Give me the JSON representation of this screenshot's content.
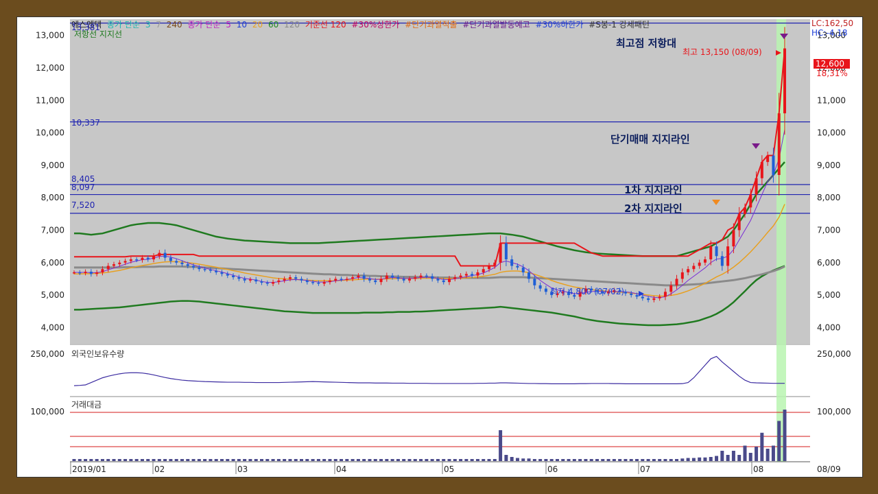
{
  "legend": {
    "stock": "에스엔텍",
    "ma_label": "종가 단순",
    "ma_periods_a": [
      "3",
      "7",
      "240"
    ],
    "ma_label_b": "종가 단순",
    "ma_periods_b": [
      "5",
      "10",
      "20",
      "60",
      "120"
    ],
    "base_line": "기준선 120",
    "items": [
      "#30%상한가",
      "#단기과열적출",
      "#단기과열발동예고",
      "#30%하한가",
      "#S봉-1 강세패턴"
    ],
    "sub_label": "저항선 지지선"
  },
  "top_right": {
    "lc": "LC:162,50",
    "hc": "HC:-4,18"
  },
  "price_badge": "12,600",
  "price_pct": "18,31%",
  "annotations": {
    "resist": "최고점 저항대",
    "short": "단기매매 지지라인",
    "s1": "1차 지지라인",
    "s2": "2차 지지라인",
    "high": "최고 13,150 (08/09)",
    "low": "최저 4,800 (07/02)"
  },
  "lines": {
    "top": "13,381",
    "l1": "10,337",
    "l2": "8,405",
    "l3": "8,097",
    "l4": "7,520"
  },
  "panels": {
    "foreign": "외국인보유수량",
    "amount": "거래대금"
  },
  "colors": {
    "up": "#e8151b",
    "down": "#1f5fd6",
    "band": "#1f7a1f",
    "hline": "#1e22b0"
  },
  "chart_data": {
    "type": "candlestick",
    "price_axis": {
      "ylim": [
        3500,
        13500
      ],
      "ticks": [
        4000,
        5000,
        6000,
        7000,
        8000,
        9000,
        10000,
        11000,
        12000,
        13000
      ],
      "tick_labels": [
        "4,000",
        "5,000",
        "6,000",
        "7,000",
        "8,000",
        "9,000",
        "10,000",
        "11,000",
        "12,000",
        "13,000"
      ]
    },
    "x_ticks": [
      "2019/01",
      "02",
      "03",
      "04",
      "05",
      "06",
      "07",
      "08"
    ],
    "x_last": "08/09",
    "hlines": [
      13381,
      10337,
      8405,
      8097,
      7520
    ],
    "price_close": [
      5700,
      5680,
      5720,
      5650,
      5700,
      5800,
      5900,
      5950,
      6000,
      6050,
      6100,
      6080,
      6150,
      6100,
      6200,
      6300,
      6150,
      6050,
      6000,
      5950,
      5900,
      5850,
      5800,
      5780,
      5750,
      5700,
      5650,
      5600,
      5550,
      5500,
      5450,
      5480,
      5420,
      5380,
      5350,
      5400,
      5450,
      5500,
      5550,
      5500,
      5450,
      5400,
      5380,
      5350,
      5400,
      5450,
      5500,
      5480,
      5500,
      5550,
      5600,
      5500,
      5450,
      5400,
      5500,
      5600,
      5550,
      5500,
      5450,
      5500,
      5550,
      5600,
      5580,
      5500,
      5450,
      5400,
      5500,
      5550,
      5600,
      5650,
      5600,
      5700,
      5800,
      5900,
      6000,
      6600,
      6100,
      5900,
      5850,
      5700,
      5500,
      5300,
      5200,
      5100,
      5000,
      5050,
      5100,
      5000,
      4950,
      5100,
      5200,
      5150,
      5100,
      5050,
      5100,
      5150,
      5100,
      5050,
      5000,
      4950,
      4900,
      4850,
      4900,
      4950,
      5100,
      5300,
      5500,
      5700,
      5800,
      5900,
      6000,
      6100,
      6500,
      6200,
      5900,
      6500,
      7000,
      7500,
      7700,
      8100,
      8600,
      9100,
      9300,
      8700,
      10600,
      12600
    ],
    "ma_short": [
      5700,
      5700,
      5700,
      5690,
      5690,
      5720,
      5780,
      5830,
      5890,
      5950,
      6010,
      6050,
      6090,
      6100,
      6140,
      6190,
      6200,
      6170,
      6120,
      6060,
      5990,
      5930,
      5880,
      5830,
      5790,
      5750,
      5710,
      5660,
      5610,
      5560,
      5510,
      5490,
      5460,
      5420,
      5390,
      5390,
      5410,
      5440,
      5470,
      5480,
      5470,
      5450,
      5420,
      5400,
      5400,
      5410,
      5440,
      5460,
      5480,
      5510,
      5540,
      5530,
      5510,
      5480,
      5490,
      5520,
      5540,
      5530,
      5510,
      5510,
      5520,
      5540,
      5550,
      5540,
      5510,
      5480,
      5480,
      5500,
      5530,
      5570,
      5600,
      5630,
      5680,
      5760,
      5850,
      6000,
      6050,
      6000,
      5950,
      5870,
      5750,
      5600,
      5450,
      5330,
      5220,
      5160,
      5120,
      5080,
      5040,
      5050,
      5080,
      5110,
      5120,
      5110,
      5100,
      5110,
      5110,
      5100,
      5080,
      5040,
      5000,
      4960,
      4930,
      4920,
      4950,
      5040,
      5160,
      5300,
      5450,
      5580,
      5710,
      5840,
      6000,
      6110,
      6130,
      6200,
      6400,
      6700,
      7000,
      7300,
      7700,
      8100,
      8500,
      8700,
      9200,
      10100
    ],
    "ma_mid": [
      5650,
      5650,
      5660,
      5660,
      5670,
      5680,
      5700,
      5730,
      5760,
      5800,
      5840,
      5880,
      5910,
      5940,
      5970,
      6000,
      6020,
      6030,
      6030,
      6020,
      6000,
      5980,
      5950,
      5920,
      5890,
      5860,
      5820,
      5790,
      5750,
      5720,
      5680,
      5650,
      5620,
      5590,
      5560,
      5530,
      5510,
      5500,
      5490,
      5480,
      5470,
      5460,
      5450,
      5440,
      5440,
      5440,
      5440,
      5450,
      5460,
      5470,
      5480,
      5490,
      5490,
      5490,
      5490,
      5500,
      5500,
      5510,
      5510,
      5510,
      5510,
      5520,
      5520,
      5520,
      5520,
      5510,
      5510,
      5510,
      5520,
      5530,
      5540,
      5560,
      5580,
      5610,
      5640,
      5700,
      5730,
      5740,
      5740,
      5720,
      5690,
      5640,
      5580,
      5520,
      5450,
      5390,
      5340,
      5290,
      5250,
      5220,
      5190,
      5170,
      5150,
      5130,
      5110,
      5100,
      5090,
      5080,
      5060,
      5040,
      5020,
      5000,
      4980,
      4970,
      4970,
      4990,
      5020,
      5070,
      5130,
      5200,
      5280,
      5360,
      5460,
      5560,
      5640,
      5740,
      5860,
      6000,
      6160,
      6330,
      6520,
      6720,
      6930,
      7130,
      7400,
      7800
    ],
    "ma_long": [
      5850,
      5850,
      5850,
      5850,
      5850,
      5850,
      5850,
      5850,
      5850,
      5860,
      5860,
      5860,
      5870,
      5870,
      5870,
      5880,
      5880,
      5880,
      5880,
      5880,
      5870,
      5870,
      5860,
      5850,
      5840,
      5830,
      5820,
      5810,
      5800,
      5790,
      5780,
      5770,
      5760,
      5750,
      5740,
      5730,
      5720,
      5710,
      5700,
      5690,
      5680,
      5670,
      5660,
      5650,
      5640,
      5640,
      5630,
      5620,
      5620,
      5610,
      5600,
      5600,
      5590,
      5590,
      5580,
      5580,
      5570,
      5570,
      5560,
      5560,
      5560,
      5550,
      5550,
      5550,
      5540,
      5540,
      5540,
      5530,
      5530,
      5530,
      5530,
      5530,
      5530,
      5530,
      5540,
      5550,
      5550,
      5550,
      5550,
      5550,
      5540,
      5530,
      5520,
      5510,
      5500,
      5490,
      5480,
      5470,
      5460,
      5450,
      5440,
      5430,
      5420,
      5410,
      5400,
      5390,
      5380,
      5370,
      5360,
      5350,
      5340,
      5330,
      5320,
      5310,
      5300,
      5300,
      5300,
      5310,
      5320,
      5330,
      5340,
      5360,
      5380,
      5400,
      5420,
      5440,
      5460,
      5490,
      5520,
      5560,
      5600,
      5640,
      5690,
      5740,
      5800,
      5880
    ],
    "resist_line": [
      6180,
      6180,
      6180,
      6180,
      6180,
      6180,
      6180,
      6180,
      6180,
      6180,
      6200,
      6200,
      6200,
      6200,
      6200,
      6250,
      6250,
      6250,
      6250,
      6250,
      6250,
      6250,
      6200,
      6200,
      6200,
      6200,
      6200,
      6200,
      6200,
      6200,
      6200,
      6200,
      6200,
      6200,
      6200,
      6200,
      6200,
      6200,
      6200,
      6200,
      6200,
      6200,
      6200,
      6200,
      6200,
      6200,
      6200,
      6200,
      6200,
      6200,
      6200,
      6200,
      6200,
      6200,
      6200,
      6200,
      6200,
      6200,
      6200,
      6200,
      6200,
      6200,
      6200,
      6200,
      6200,
      6200,
      6200,
      6200,
      5900,
      5900,
      5900,
      5900,
      5900,
      5900,
      5900,
      6600,
      6600,
      6600,
      6600,
      6600,
      6600,
      6600,
      6600,
      6600,
      6600,
      6600,
      6600,
      6600,
      6600,
      6500,
      6400,
      6300,
      6250,
      6200,
      6200,
      6200,
      6200,
      6200,
      6200,
      6200,
      6200,
      6200,
      6200,
      6200,
      6200,
      6200,
      6200,
      6200,
      6200,
      6300,
      6400,
      6500,
      6600,
      6600,
      6700,
      7000,
      7100,
      7500,
      7700,
      8100,
      8600,
      9100,
      9300,
      9300,
      10600,
      12600
    ],
    "band_upper": [
      6900,
      6900,
      6880,
      6860,
      6880,
      6900,
      6950,
      7000,
      7050,
      7100,
      7150,
      7180,
      7200,
      7220,
      7220,
      7220,
      7200,
      7180,
      7150,
      7100,
      7050,
      7000,
      6950,
      6900,
      6850,
      6800,
      6770,
      6740,
      6720,
      6700,
      6680,
      6670,
      6660,
      6650,
      6640,
      6630,
      6620,
      6610,
      6600,
      6600,
      6600,
      6600,
      6600,
      6600,
      6610,
      6620,
      6630,
      6640,
      6650,
      6660,
      6670,
      6680,
      6690,
      6700,
      6710,
      6720,
      6730,
      6740,
      6750,
      6760,
      6770,
      6780,
      6790,
      6800,
      6810,
      6820,
      6830,
      6840,
      6850,
      6860,
      6870,
      6880,
      6890,
      6900,
      6900,
      6900,
      6880,
      6860,
      6830,
      6800,
      6750,
      6700,
      6650,
      6600,
      6550,
      6500,
      6460,
      6420,
      6380,
      6350,
      6320,
      6300,
      6280,
      6270,
      6260,
      6250,
      6240,
      6230,
      6220,
      6210,
      6200,
      6200,
      6200,
      6200,
      6200,
      6200,
      6200,
      6250,
      6300,
      6350,
      6400,
      6450,
      6500,
      6600,
      6700,
      6800,
      7000,
      7250,
      7500,
      7800,
      8100,
      8300,
      8500,
      8700,
      8900,
      9100
    ],
    "band_lower": [
      4550,
      4550,
      4560,
      4570,
      4580,
      4590,
      4600,
      4610,
      4620,
      4640,
      4660,
      4680,
      4700,
      4720,
      4740,
      4760,
      4780,
      4800,
      4810,
      4820,
      4820,
      4810,
      4800,
      4780,
      4760,
      4740,
      4720,
      4700,
      4680,
      4660,
      4640,
      4620,
      4600,
      4580,
      4560,
      4540,
      4520,
      4500,
      4490,
      4480,
      4470,
      4460,
      4450,
      4450,
      4450,
      4450,
      4450,
      4450,
      4450,
      4450,
      4450,
      4460,
      4460,
      4460,
      4460,
      4470,
      4470,
      4480,
      4480,
      4480,
      4490,
      4490,
      4500,
      4510,
      4520,
      4530,
      4540,
      4550,
      4560,
      4570,
      4580,
      4590,
      4600,
      4610,
      4620,
      4640,
      4620,
      4600,
      4580,
      4560,
      4540,
      4520,
      4500,
      4480,
      4460,
      4430,
      4400,
      4370,
      4340,
      4300,
      4260,
      4230,
      4200,
      4180,
      4160,
      4140,
      4120,
      4110,
      4100,
      4090,
      4080,
      4070,
      4070,
      4070,
      4080,
      4090,
      4100,
      4120,
      4150,
      4180,
      4220,
      4280,
      4340,
      4420,
      4520,
      4640,
      4780,
      4950,
      5120,
      5300,
      5460,
      5580,
      5680,
      5760,
      5830,
      5900
    ],
    "foreign_holdings": [
      60,
      62,
      65,
      80,
      95,
      110,
      120,
      128,
      135,
      140,
      142,
      142,
      140,
      135,
      128,
      120,
      112,
      105,
      100,
      95,
      92,
      90,
      88,
      86,
      85,
      84,
      83,
      82,
      82,
      82,
      81,
      81,
      80,
      80,
      80,
      80,
      80,
      81,
      82,
      83,
      84,
      85,
      86,
      85,
      84,
      83,
      82,
      81,
      80,
      79,
      78,
      78,
      78,
      77,
      77,
      77,
      76,
      76,
      76,
      75,
      75,
      75,
      75,
      74,
      74,
      74,
      74,
      74,
      74,
      74,
      74,
      75,
      75,
      76,
      76,
      78,
      78,
      77,
      76,
      75,
      74,
      74,
      73,
      73,
      72,
      72,
      72,
      72,
      72,
      73,
      73,
      74,
      74,
      74,
      74,
      73,
      73,
      72,
      72,
      72,
      72,
      72,
      72,
      72,
      72,
      72,
      72,
      73,
      80,
      110,
      150,
      190,
      230,
      245,
      210,
      180,
      150,
      120,
      95,
      80,
      78,
      77,
      76,
      75,
      75,
      75
    ],
    "amount": [
      4,
      4,
      4,
      4,
      4,
      4,
      4,
      4,
      4,
      4,
      4,
      4,
      4,
      4,
      4,
      4,
      4,
      4,
      4,
      4,
      4,
      4,
      4,
      4,
      4,
      4,
      4,
      4,
      4,
      4,
      4,
      4,
      4,
      4,
      4,
      4,
      4,
      4,
      4,
      4,
      4,
      4,
      4,
      4,
      4,
      4,
      4,
      4,
      4,
      4,
      4,
      4,
      4,
      4,
      4,
      4,
      4,
      4,
      4,
      4,
      4,
      4,
      4,
      4,
      4,
      4,
      4,
      4,
      4,
      4,
      4,
      4,
      4,
      4,
      4,
      60,
      12,
      8,
      6,
      5,
      5,
      4,
      4,
      4,
      4,
      4,
      4,
      4,
      4,
      4,
      4,
      4,
      4,
      4,
      4,
      4,
      4,
      4,
      4,
      4,
      4,
      4,
      4,
      4,
      4,
      4,
      4,
      5,
      6,
      6,
      7,
      7,
      8,
      10,
      20,
      12,
      20,
      12,
      30,
      16,
      28,
      55,
      24,
      30,
      78,
      100
    ],
    "amount_axis": {
      "ylim": [
        0,
        110000
      ],
      "tick_labels": [
        "100,000"
      ]
    },
    "foreign_axis": {
      "tick_labels": [
        "250,000"
      ]
    }
  }
}
